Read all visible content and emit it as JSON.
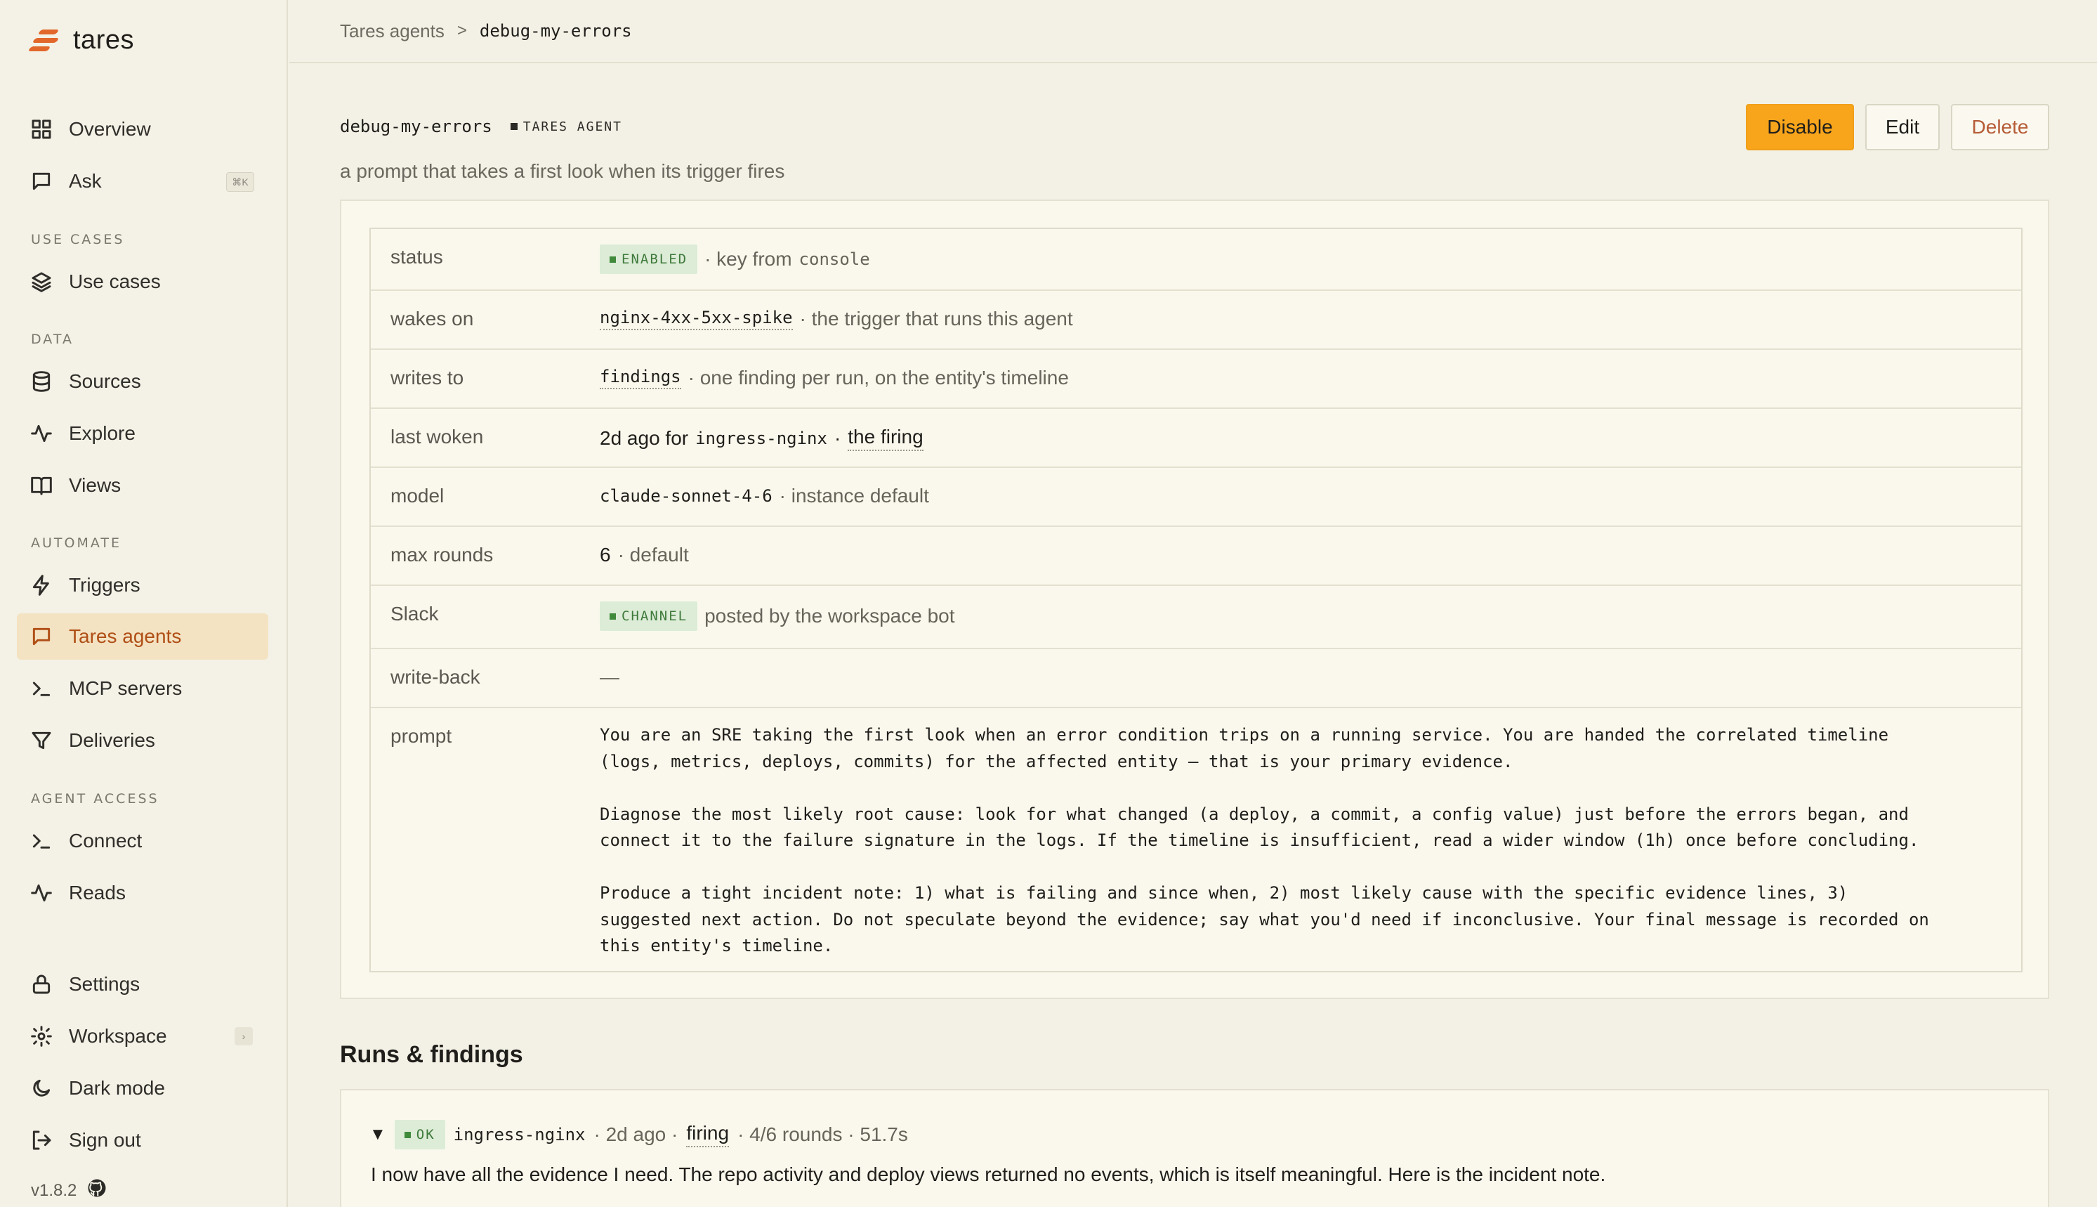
{
  "app": {
    "name": "tares",
    "version": "v1.8.2"
  },
  "sidebar": {
    "items_top": [
      {
        "label": "Overview",
        "icon": "grid-icon"
      },
      {
        "label": "Ask",
        "icon": "chat-icon",
        "shortcut": "⌘K"
      }
    ],
    "sections": {
      "use_cases": "USE CASES",
      "data": "DATA",
      "automate": "AUTOMATE",
      "agent_access": "AGENT ACCESS"
    },
    "use_cases": {
      "label": "Use cases",
      "icon": "layers-icon"
    },
    "data_items": [
      {
        "label": "Sources",
        "icon": "database-icon"
      },
      {
        "label": "Explore",
        "icon": "activity-icon"
      },
      {
        "label": "Views",
        "icon": "book-icon"
      }
    ],
    "automate_items": [
      {
        "label": "Triggers",
        "icon": "bolt-icon"
      },
      {
        "label": "Tares agents",
        "icon": "chat-icon",
        "active": true
      },
      {
        "label": "MCP servers",
        "icon": "terminal-icon"
      },
      {
        "label": "Deliveries",
        "icon": "filter-icon"
      }
    ],
    "agent_access_items": [
      {
        "label": "Connect",
        "icon": "terminal-icon"
      },
      {
        "label": "Reads",
        "icon": "activity-icon"
      }
    ],
    "bottom_items": [
      {
        "label": "Settings",
        "icon": "lock-icon"
      },
      {
        "label": "Workspace",
        "icon": "gear-icon",
        "arrow": "›"
      },
      {
        "label": "Dark mode",
        "icon": "moon-icon"
      },
      {
        "label": "Sign out",
        "icon": "logout-icon"
      }
    ]
  },
  "breadcrumb": {
    "parent": "Tares agents",
    "separator": ">",
    "current": "debug-my-errors"
  },
  "agent": {
    "name": "debug-my-errors",
    "type": "TARES AGENT",
    "description": "a prompt that takes a first look when its trigger fires"
  },
  "actions": {
    "disable": "Disable",
    "edit": "Edit",
    "delete": "Delete"
  },
  "properties": {
    "status": {
      "key": "status",
      "badge": "ENABLED",
      "rest": "· key from",
      "code": "console"
    },
    "wakes_on": {
      "key": "wakes on",
      "code": "nginx-4xx-5xx-spike",
      "rest": "· the trigger that runs this agent"
    },
    "writes_to": {
      "key": "writes to",
      "code": "findings",
      "rest": "· one finding per run, on the entity's timeline"
    },
    "last_woken": {
      "key": "last woken",
      "pre": "2d ago for",
      "code": "ingress-nginx",
      "sep": "·",
      "link": "the firing"
    },
    "model": {
      "key": "model",
      "code": "claude-sonnet-4-6",
      "rest": "· instance default"
    },
    "max_rounds": {
      "key": "max rounds",
      "value": "6",
      "rest": "· default"
    },
    "slack": {
      "key": "Slack",
      "badge": "CHANNEL",
      "rest": "posted by the workspace bot"
    },
    "write_back": {
      "key": "write-back",
      "value": "—"
    },
    "prompt": {
      "key": "prompt",
      "text": "You are an SRE taking the first look when an error condition trips on a running service. You are handed the correlated timeline\n(logs, metrics, deploys, commits) for the affected entity — that is your primary evidence.\n\nDiagnose the most likely root cause: look for what changed (a deploy, a commit, a config value) just before the errors began, and\nconnect it to the failure signature in the logs. If the timeline is insufficient, read a wider window (1h) once before concluding.\n\nProduce a tight incident note: 1) what is failing and since when, 2) most likely cause with the specific evidence lines, 3)\nsuggested next action. Do not speculate beyond the evidence; say what you'd need if inconclusive. Your final message is recorded on\nthis entity's timeline."
    }
  },
  "runs": {
    "title": "Runs & findings",
    "items": [
      {
        "toggle": "▼",
        "badge": "OK",
        "entity": "ingress-nginx",
        "age": "· 2d ago ·",
        "trigger_link": "firing",
        "stats": "· 4/6 rounds · 51.7s",
        "body": "I now have all the evidence I need. The repo activity and deploy views returned no events, which is itself meaningful. Here is the incident note."
      }
    ]
  },
  "colors": {
    "accent": "#f8a51c",
    "brand": "#e2672b",
    "active_bg": "#f4e3c2",
    "badge_green": "#3f7a3b",
    "delete": "#b65b37"
  }
}
